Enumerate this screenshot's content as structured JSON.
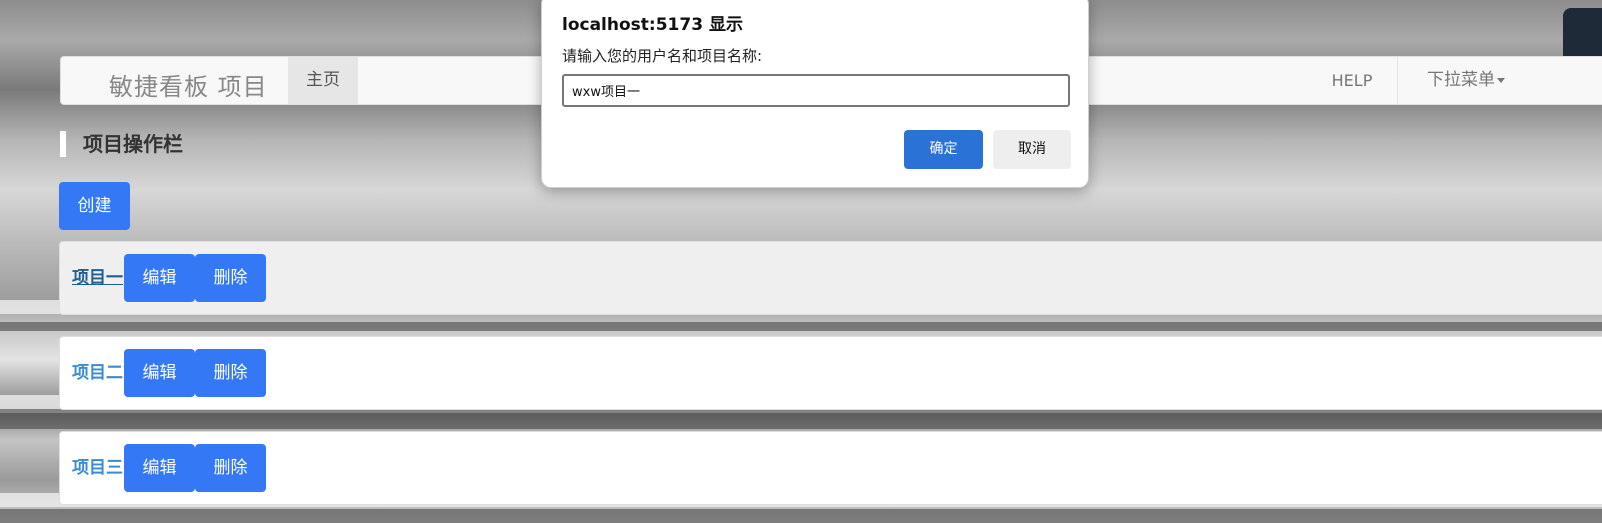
{
  "navbar": {
    "brand": "敏捷看板 项目",
    "home": "主页",
    "help": "HELP",
    "dropdown": "下拉菜单"
  },
  "section": {
    "title": "项目操作栏",
    "create_label": "创建"
  },
  "projects": [
    {
      "name": "项目一",
      "edit_label": "编辑",
      "delete_label": "删除"
    },
    {
      "name": "项目二",
      "edit_label": "编辑",
      "delete_label": "删除"
    },
    {
      "name": "项目三",
      "edit_label": "编辑",
      "delete_label": "删除"
    }
  ],
  "dialog": {
    "title": "localhost:5173 显示",
    "message": "请输入您的用户名和项目名称:",
    "input_value": "wxw项目一",
    "ok_label": "确定",
    "cancel_label": "取消"
  },
  "colors": {
    "primary_button": "#3478f6",
    "dialog_ok": "#2a72d5",
    "project_link": "#3a8bd0"
  }
}
